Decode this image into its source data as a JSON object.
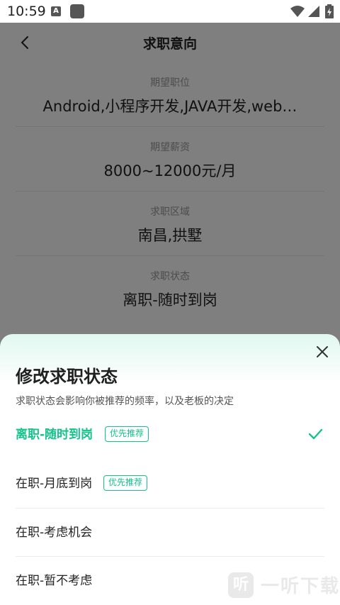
{
  "status_bar": {
    "time": "10:59",
    "notif_letter": "A"
  },
  "nav": {
    "title": "求职意向"
  },
  "fields": [
    {
      "label": "期望职位",
      "value": "Android,小程序开发,JAVA开发,web…"
    },
    {
      "label": "期望薪资",
      "value": "8000~12000元/月"
    },
    {
      "label": "求职区域",
      "value": "南昌,拱墅"
    },
    {
      "label": "求职状态",
      "value": "离职-随时到岗"
    }
  ],
  "sheet": {
    "title": "修改求职状态",
    "subtitle": "求职状态会影响你被推荐的频率，以及老板的决定",
    "options": [
      {
        "label": "离职-随时到岗",
        "badge": "优先推荐",
        "selected": true
      },
      {
        "label": "在职-月底到岗",
        "badge": "优先推荐",
        "selected": false
      },
      {
        "label": "在职-考虑机会",
        "badge": "",
        "selected": false
      },
      {
        "label": "在职-暂不考虑",
        "badge": "",
        "selected": false
      }
    ]
  },
  "watermark": {
    "logo_char": "听",
    "text": "一听下载"
  },
  "colors": {
    "accent": "#15c28a",
    "overlay": "rgba(0,0,0,0.5)"
  }
}
